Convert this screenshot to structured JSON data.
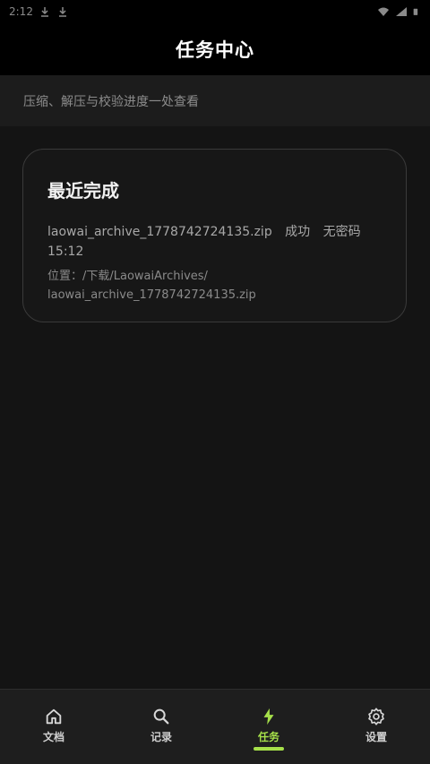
{
  "status_bar": {
    "time": "2:12"
  },
  "header": {
    "title": "任务中心"
  },
  "subtitle": "压缩、解压与校验进度一处查看",
  "recent": {
    "title": "最近完成",
    "items": [
      {
        "file_name": "laowai_archive_1778742724135.zip",
        "status": "成功",
        "password": "无密码",
        "time": "15:12",
        "location_label": "位置：/下载/LaowaiArchives/",
        "location_file": "laowai_archive_1778742724135.zip"
      }
    ]
  },
  "bottom_nav": {
    "items": [
      {
        "label": "文档",
        "icon": "home-icon"
      },
      {
        "label": "记录",
        "icon": "search-icon"
      },
      {
        "label": "任务",
        "icon": "lightning-icon"
      },
      {
        "label": "设置",
        "icon": "gear-icon"
      }
    ],
    "active_index": 2
  },
  "colors": {
    "accent": "#a6e04a",
    "background": "#141414"
  }
}
